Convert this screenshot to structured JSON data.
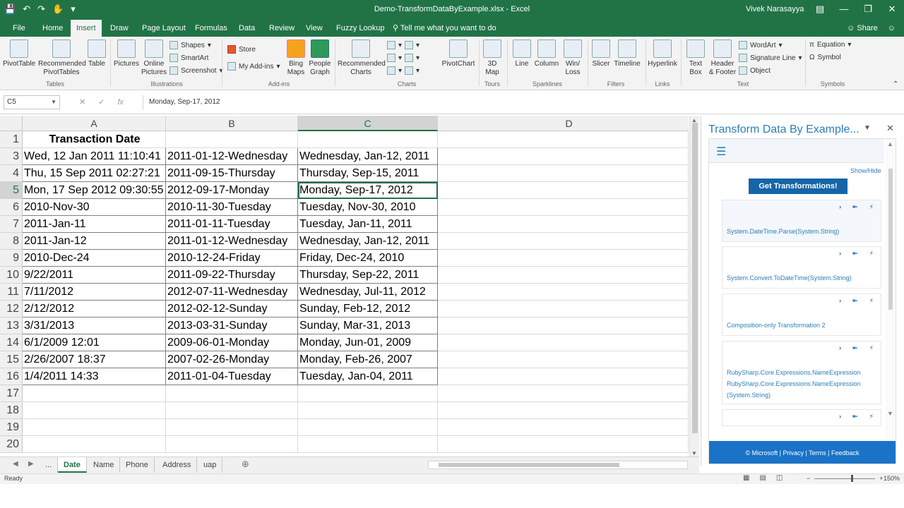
{
  "window": {
    "title": "Demo-TransformDataByExample.xlsx - Excel",
    "user": "Vivek Narasayya"
  },
  "tabs": [
    "File",
    "Home",
    "Insert",
    "Draw",
    "Page Layout",
    "Formulas",
    "Data",
    "Review",
    "View",
    "Fuzzy Lookup"
  ],
  "active_tab": "Insert",
  "tell_me": "Tell me what you want to do",
  "share": "Share",
  "ribbon": {
    "pivottable": "PivotTable",
    "recommended_pivot": "Recommended PivotTables",
    "table": "Table",
    "pictures": "Pictures",
    "online_pictures": "Online Pictures",
    "shapes": "Shapes",
    "smartart": "SmartArt",
    "screenshot": "Screenshot",
    "store": "Store",
    "my_addins": "My Add-ins",
    "bing_maps": "Bing Maps",
    "people_graph": "People Graph",
    "recommended_charts": "Recommended Charts",
    "pivotchart": "PivotChart",
    "map3d": "3D Map",
    "line": "Line",
    "column": "Column",
    "winloss": "Win/ Loss",
    "slicer": "Slicer",
    "timeline": "Timeline",
    "hyperlink": "Hyperlink",
    "textbox": "Text Box",
    "header_footer": "Header & Footer",
    "wordart": "WordArt",
    "signature_line": "Signature Line",
    "object": "Object",
    "equation": "Equation",
    "symbol": "Symbol",
    "groups": [
      "Tables",
      "Illustrations",
      "Add-ins",
      "Charts",
      "Tours",
      "Sparklines",
      "Filters",
      "Links",
      "Text",
      "Symbols"
    ]
  },
  "namebox": "C5",
  "formula": "Monday, Sep-17, 2012",
  "columns": [
    "A",
    "B",
    "C",
    "D"
  ],
  "header_cell": "Transaction Date",
  "rows": [
    {
      "n": "1",
      "a": "",
      "b": "",
      "c": ""
    },
    {
      "n": "3",
      "a": "Wed, 12 Jan 2011 11:10:41",
      "b": "2011-01-12-Wednesday",
      "c": "Wednesday, Jan-12, 2011"
    },
    {
      "n": "4",
      "a": "Thu, 15 Sep 2011 02:27:21",
      "b": "2011-09-15-Thursday",
      "c": "Thursday, Sep-15, 2011"
    },
    {
      "n": "5",
      "a": "Mon, 17 Sep 2012 09:30:55",
      "b": "2012-09-17-Monday",
      "c": "Monday, Sep-17, 2012"
    },
    {
      "n": "6",
      "a": "2010-Nov-30",
      "b": "2010-11-30-Tuesday",
      "c": "Tuesday, Nov-30, 2010"
    },
    {
      "n": "7",
      "a": "2011-Jan-11",
      "b": "2011-01-11-Tuesday",
      "c": "Tuesday, Jan-11, 2011"
    },
    {
      "n": "8",
      "a": "2011-Jan-12",
      "b": "2011-01-12-Wednesday",
      "c": "Wednesday, Jan-12, 2011"
    },
    {
      "n": "9",
      "a": "2010-Dec-24",
      "b": "2010-12-24-Friday",
      "c": "Friday, Dec-24, 2010"
    },
    {
      "n": "10",
      "a": "9/22/2011",
      "b": "2011-09-22-Thursday",
      "c": "Thursday, Sep-22, 2011"
    },
    {
      "n": "11",
      "a": "7/11/2012",
      "b": "2012-07-11-Wednesday",
      "c": "Wednesday, Jul-11, 2012"
    },
    {
      "n": "12",
      "a": "2/12/2012",
      "b": "2012-02-12-Sunday",
      "c": "Sunday, Feb-12, 2012"
    },
    {
      "n": "13",
      "a": "3/31/2013",
      "b": "2013-03-31-Sunday",
      "c": "Sunday, Mar-31, 2013"
    },
    {
      "n": "14",
      "a": "6/1/2009 12:01",
      "b": "2009-06-01-Monday",
      "c": "Monday, Jun-01, 2009"
    },
    {
      "n": "15",
      "a": "2/26/2007 18:37",
      "b": "2007-02-26-Monday",
      "c": "Monday, Feb-26, 2007"
    },
    {
      "n": "16",
      "a": "1/4/2011 14:33",
      "b": "2011-01-04-Tuesday",
      "c": "Tuesday, Jan-04, 2011"
    },
    {
      "n": "17",
      "a": "",
      "b": "",
      "c": ""
    },
    {
      "n": "18",
      "a": "",
      "b": "",
      "c": ""
    },
    {
      "n": "19",
      "a": "",
      "b": "",
      "c": ""
    },
    {
      "n": "20",
      "a": "",
      "b": "",
      "c": ""
    }
  ],
  "sheet_tabs": [
    "...",
    "Date",
    "Name",
    "Phone",
    "Address",
    "uap"
  ],
  "active_sheet": "Date",
  "status": {
    "ready": "Ready",
    "zoom": "150%"
  },
  "pane": {
    "title": "Transform Data By Example...",
    "show_hide": "Show/Hide",
    "get_button": "Get Transformations!",
    "cards": [
      {
        "lines": [
          "System.DateTime.Parse(System.String)"
        ]
      },
      {
        "lines": [
          "System.Convert.ToDateTime(System.String)"
        ]
      },
      {
        "lines": [
          "Composition-only Transformation 2"
        ]
      },
      {
        "lines": [
          "RubySharp.Core.Expressions.NameExpression",
          "RubySharp.Core.Expressions.NameExpression",
          "(System.String)"
        ]
      },
      {
        "lines": []
      }
    ],
    "footer": "© Microsoft  |  Privacy  |  Terms  |  Feedback"
  },
  "colors": {
    "excel_green": "#217346",
    "pane_blue": "#2b7fb8",
    "button_blue": "#1565a8"
  }
}
